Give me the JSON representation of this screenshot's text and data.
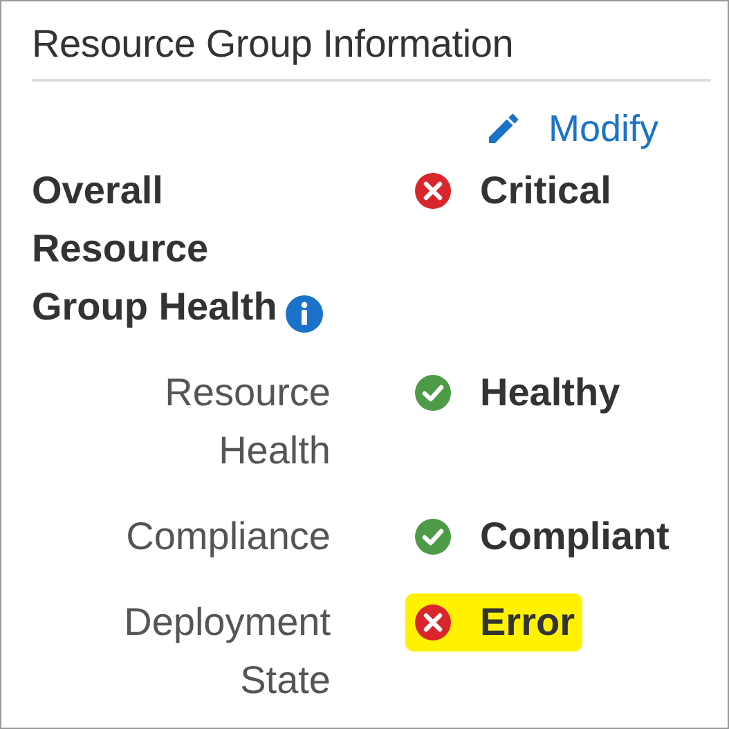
{
  "panel": {
    "title": "Resource Group Information",
    "action": {
      "label": "Modify"
    }
  },
  "rows": [
    {
      "kind": "summary",
      "label": "Overall Resource Group Health",
      "info": true,
      "status": {
        "kind": "critical",
        "text": "Critical",
        "highlighted": false
      }
    },
    {
      "kind": "detail",
      "label": "Resource Health",
      "info": false,
      "status": {
        "kind": "healthy",
        "text": "Healthy",
        "highlighted": false
      }
    },
    {
      "kind": "detail",
      "label": "Compliance",
      "info": false,
      "status": {
        "kind": "healthy",
        "text": "Compliant",
        "highlighted": false
      }
    },
    {
      "kind": "detail",
      "label": "Deployment State",
      "info": false,
      "status": {
        "kind": "critical",
        "text": "Error",
        "highlighted": true
      }
    }
  ]
}
